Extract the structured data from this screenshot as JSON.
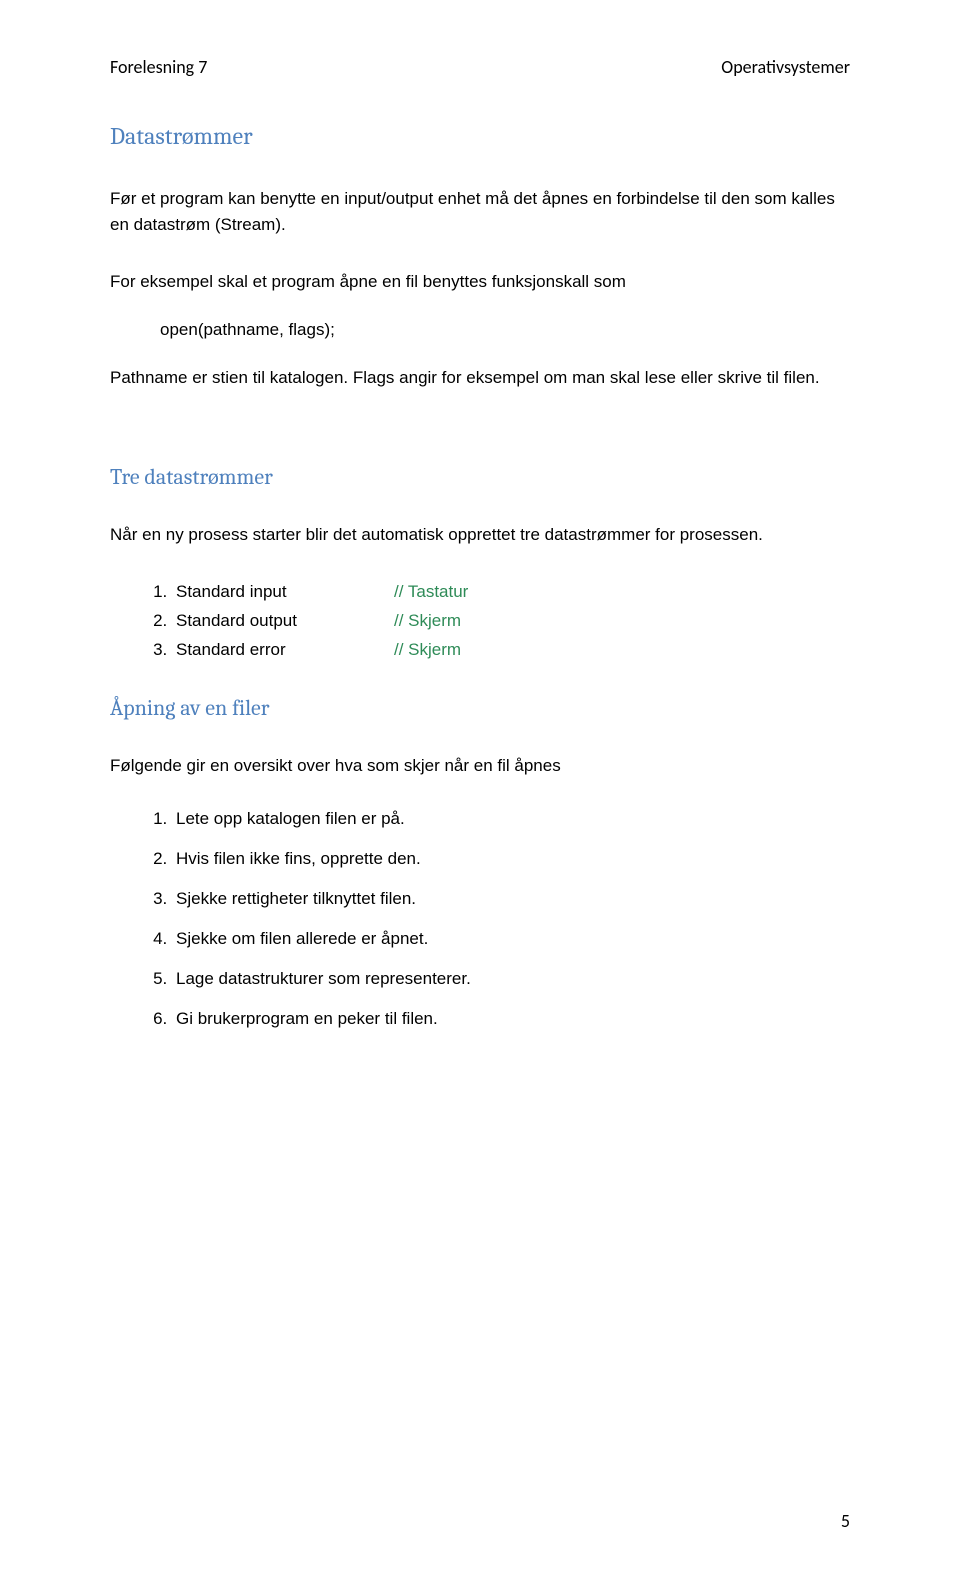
{
  "header": {
    "left": "Forelesning 7",
    "right": "Operativsystemer"
  },
  "title1": "Datastrømmer",
  "para1": "Før et program kan benytte en input/output enhet må det åpnes en forbindelse til den som kalles en datastrøm (Stream).",
  "para2": "For eksempel skal et program åpne en fil benyttes funksjonskall som",
  "code1": "open(pathname, flags);",
  "para3": "Pathname er stien til katalogen. Flags angir for eksempel om man skal lese eller skrive til filen.",
  "title2": "Tre datastrømmer",
  "para4": "Når en ny prosess starter blir det automatisk opprettet tre datastrømmer for prosessen.",
  "streams": [
    {
      "label": "Standard input",
      "comment": "// Tastatur"
    },
    {
      "label": "Standard output",
      "comment": "// Skjerm"
    },
    {
      "label": "Standard error",
      "comment": "// Skjerm"
    }
  ],
  "title3": "Åpning av en filer",
  "para5": "Følgende gir en oversikt over hva som skjer når en fil åpnes",
  "openSteps": [
    "Lete opp katalogen filen er på.",
    "Hvis filen ikke fins, opprette den.",
    "Sjekke rettigheter tilknyttet filen.",
    "Sjekke om filen allerede er åpnet.",
    "Lage datastrukturer som representerer.",
    "Gi brukerprogram en peker til filen."
  ],
  "pageNumber": "5"
}
